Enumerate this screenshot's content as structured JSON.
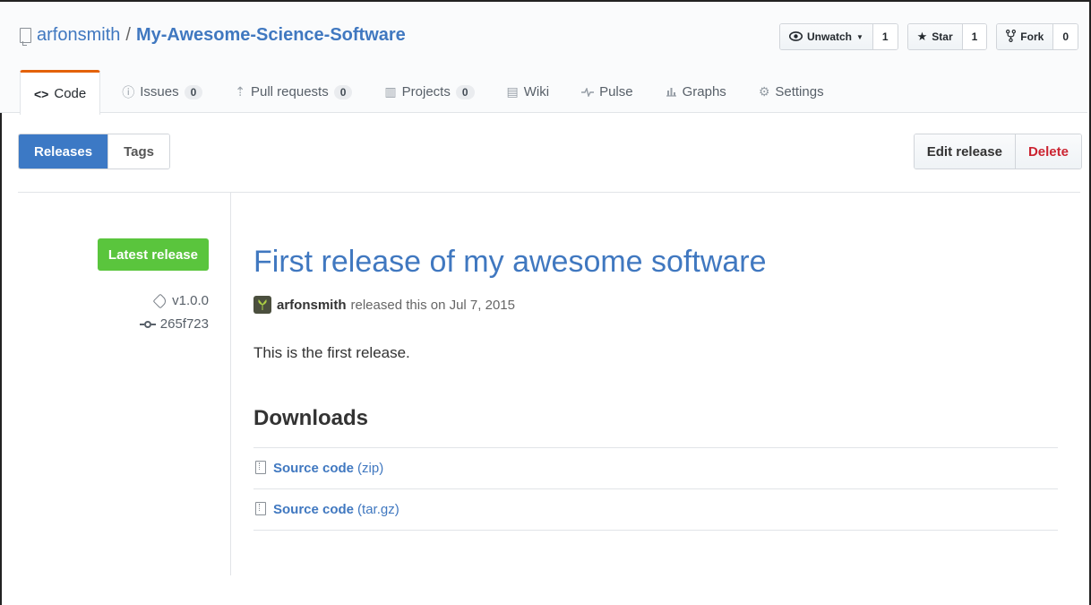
{
  "repo": {
    "owner": "arfonsmith",
    "separator": "/",
    "name": "My-Awesome-Science-Software"
  },
  "actions": {
    "watch": {
      "label": "Unwatch",
      "count": "1",
      "icon": "eye-icon"
    },
    "star": {
      "label": "Star",
      "count": "1",
      "icon": "star-icon"
    },
    "fork": {
      "label": "Fork",
      "count": "0",
      "icon": "fork-icon"
    }
  },
  "tabs": [
    {
      "label": "Code",
      "icon": "code-icon",
      "selected": true
    },
    {
      "label": "Issues",
      "count": "0",
      "icon": "issue-icon"
    },
    {
      "label": "Pull requests",
      "count": "0",
      "icon": "pull-request-icon"
    },
    {
      "label": "Projects",
      "count": "0",
      "icon": "project-icon"
    },
    {
      "label": "Wiki",
      "icon": "book-icon"
    },
    {
      "label": "Pulse",
      "icon": "pulse-icon"
    },
    {
      "label": "Graphs",
      "icon": "graph-icon"
    },
    {
      "label": "Settings",
      "icon": "gear-icon"
    }
  ],
  "subnav": {
    "releases": "Releases",
    "tags": "Tags"
  },
  "release_actions": {
    "edit": "Edit release",
    "delete": "Delete"
  },
  "meta": {
    "latest_label": "Latest release",
    "tag": "v1.0.0",
    "commit": "265f723"
  },
  "release": {
    "title": "First release of my awesome software",
    "author": "arfonsmith",
    "released_text": "released this on Jul 7, 2015",
    "body": "This is the first release.",
    "downloads_heading": "Downloads",
    "downloads": [
      {
        "name": "Source code",
        "ext": "(zip)"
      },
      {
        "name": "Source code",
        "ext": "(tar.gz)"
      }
    ]
  },
  "colors": {
    "link": "#4078c0",
    "accent_tab": "#e36209",
    "latest_green": "#5ac53d",
    "subnav_active": "#3c79c5",
    "delete_red": "#cb2431"
  }
}
